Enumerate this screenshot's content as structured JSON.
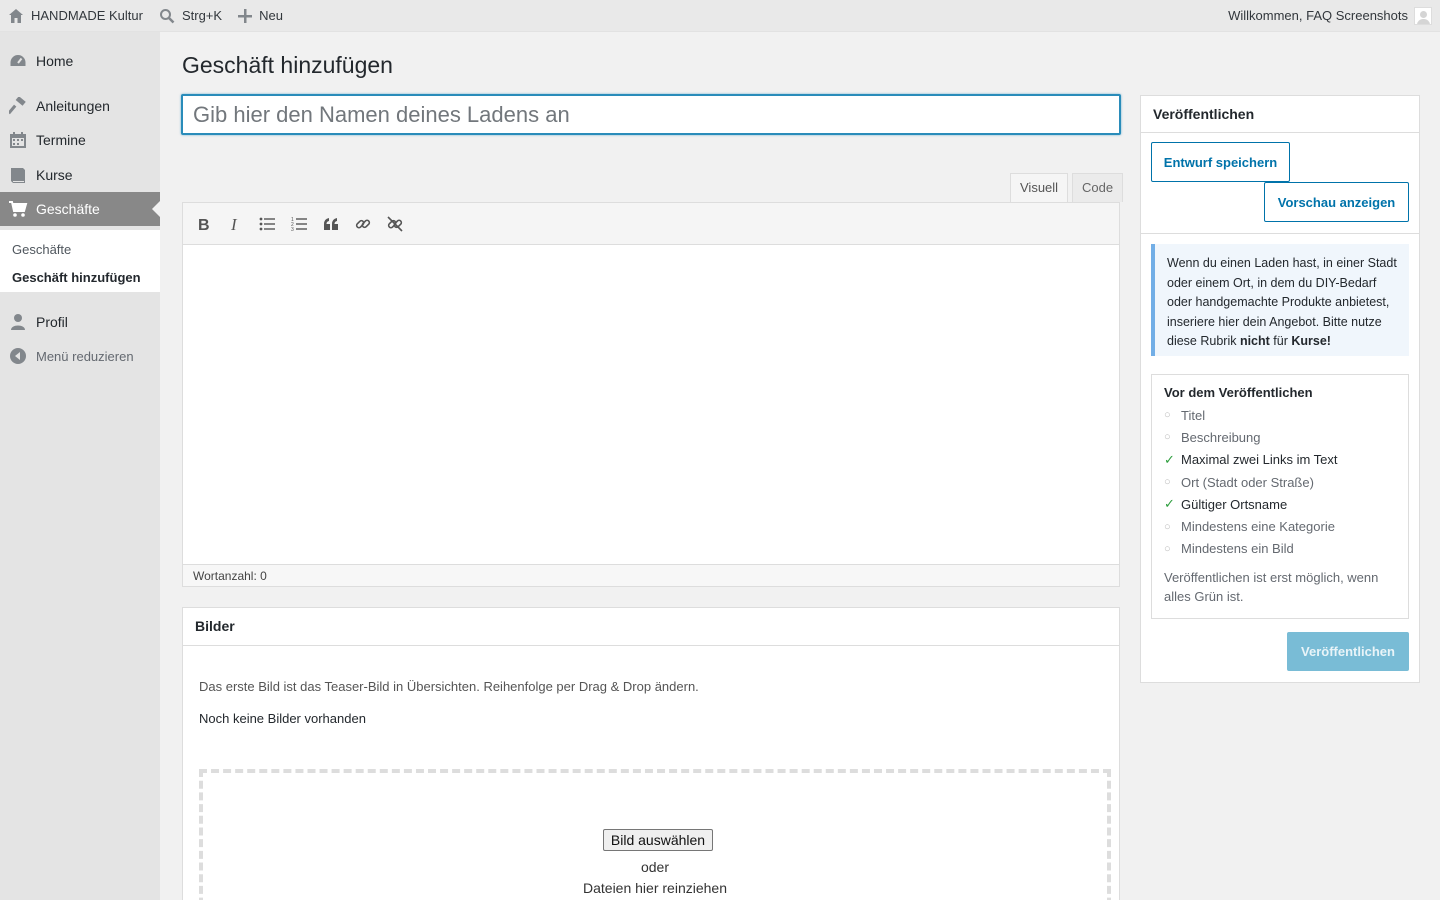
{
  "adminbar": {
    "site_name": "HANDMADE Kultur",
    "search_shortcut": "Strg+K",
    "new_label": "Neu",
    "welcome": "Willkommen, FAQ Screenshots"
  },
  "sidebar": {
    "items": [
      {
        "label": "Home",
        "icon": "dashboard-icon"
      },
      {
        "label": "Anleitungen",
        "icon": "hammer-icon"
      },
      {
        "label": "Termine",
        "icon": "calendar-icon"
      },
      {
        "label": "Kurse",
        "icon": "book-icon"
      },
      {
        "label": "Geschäfte",
        "icon": "cart-icon",
        "active": true
      },
      {
        "label": "Profil",
        "icon": "user-icon"
      }
    ],
    "submenu": [
      "Geschäfte",
      "Geschäft hinzufügen"
    ],
    "collapse_label": "Menü reduzieren"
  },
  "main": {
    "page_title": "Geschäft hinzufügen",
    "title_placeholder": "Gib hier den Namen deines Ladens an",
    "tabs": {
      "visual": "Visuell",
      "code": "Code"
    },
    "word_count": "Wortanzahl: 0",
    "images": {
      "title": "Bilder",
      "description": "Das erste Bild ist das Teaser-Bild in Übersichten. Reihenfolge per Drag & Drop ändern.",
      "empty": "Noch keine Bilder vorhanden",
      "select_button": "Bild auswählen",
      "or": "oder",
      "drag_text": "Dateien hier reinziehen"
    }
  },
  "publish": {
    "title": "Veröffentlichen",
    "save_draft": "Entwurf speichern",
    "preview": "Vorschau anzeigen",
    "notice_before": "Wenn du einen Laden hast, in einer Stadt oder einem Ort, in dem du DIY-Bedarf oder handgemachte Produkte anbietest, inseriere hier dein Angebot. Bitte nutze diese Rubrik ",
    "notice_bold1": "nicht",
    "notice_mid": " für ",
    "notice_bold2": "Kurse!",
    "checklist_title": "Vor dem Veröffentlichen",
    "checklist": [
      {
        "label": "Titel",
        "done": false
      },
      {
        "label": "Beschreibung",
        "done": false
      },
      {
        "label": "Maximal zwei Links im Text",
        "done": true
      },
      {
        "label": "Ort (Stadt oder Straße)",
        "done": false
      },
      {
        "label": "Gültiger Ortsname",
        "done": true
      },
      {
        "label": "Mindestens eine Kategorie",
        "done": false
      },
      {
        "label": "Mindestens ein Bild",
        "done": false
      }
    ],
    "checklist_note": "Veröffentlichen ist erst möglich, wenn alles Grün ist.",
    "publish_button": "Veröffentlichen",
    "colors": {
      "accent": "#0073aa",
      "notice_border": "#72aee6",
      "check_green": "#2e9e3e",
      "publish_disabled": "#79bcd6"
    }
  }
}
